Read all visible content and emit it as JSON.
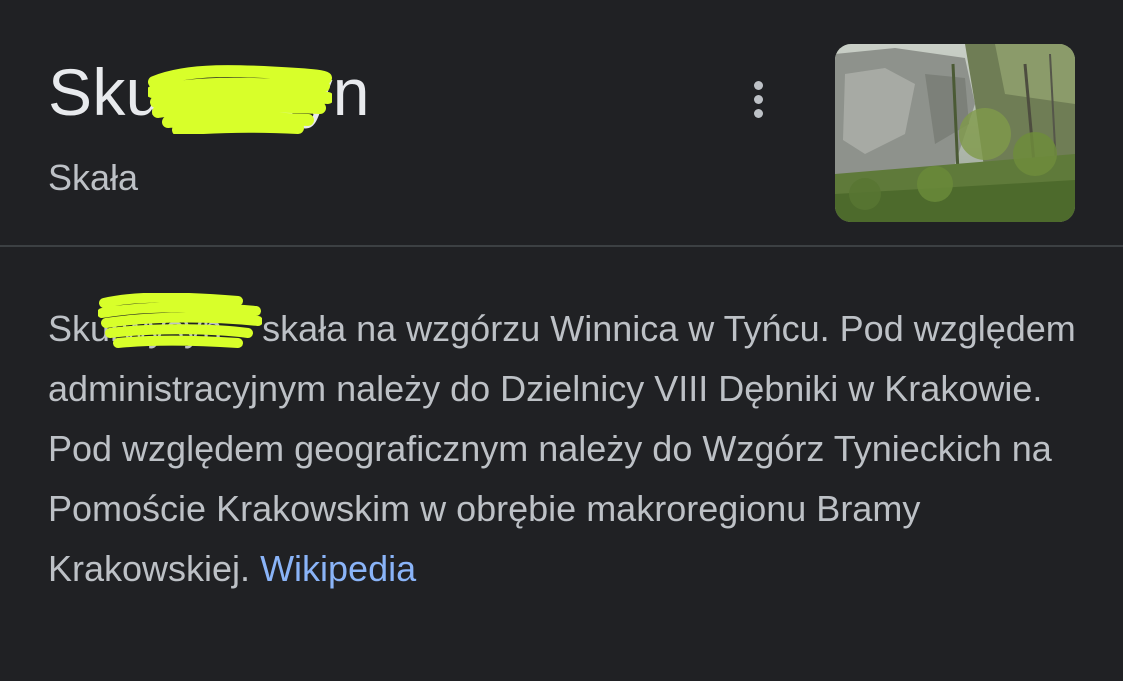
{
  "entity": {
    "title": "Skurwysyn",
    "subtitle": "Skała",
    "more_options_icon": "more-vert-icon",
    "thumbnail_description": "",
    "redaction_color": "#d8ff2a"
  },
  "description": {
    "name": "Skurwysyn",
    "text": " – skała na wzgórzu Winnica w Tyńcu. Pod względem administracyjnym należy do Dzielnicy VIII Dębniki w Krakowie. Pod względem geograficznym należy do Wzgórz Tynieckich na Pomoście Krakowskim w obrębie makroregionu Bramy Krakowskiej. ",
    "source_label": "Wikipedia"
  },
  "colors": {
    "background": "#202124",
    "title": "#e8eaed",
    "text": "#bdc1c6",
    "link": "#8ab4f8",
    "divider": "#3c4043"
  }
}
